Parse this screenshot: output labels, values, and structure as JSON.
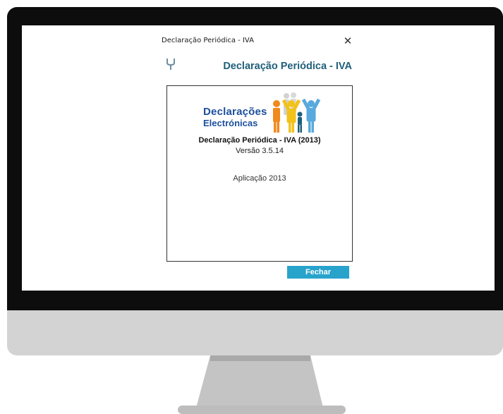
{
  "window": {
    "title": "Declaração Periódica - IVA",
    "close_glyph": "✕"
  },
  "header": {
    "icon": "tuning-fork-icon",
    "title": "Declaração Periódica - IVA"
  },
  "logo": {
    "line1": "Declarações",
    "line2": "Electrónicas",
    "colors": {
      "text": "#1c4f9c",
      "orange": "#f08a1c",
      "yellow": "#f2c21a",
      "blue": "#58a9dd",
      "grey": "#c8c8c8"
    }
  },
  "about": {
    "app_name": "Declaração Periódica - IVA (2013)",
    "version": "Versão 3.5.14",
    "application_year": "Aplicação 2013"
  },
  "actions": {
    "close_label": "Fechar",
    "accent": "#27a3cc"
  }
}
